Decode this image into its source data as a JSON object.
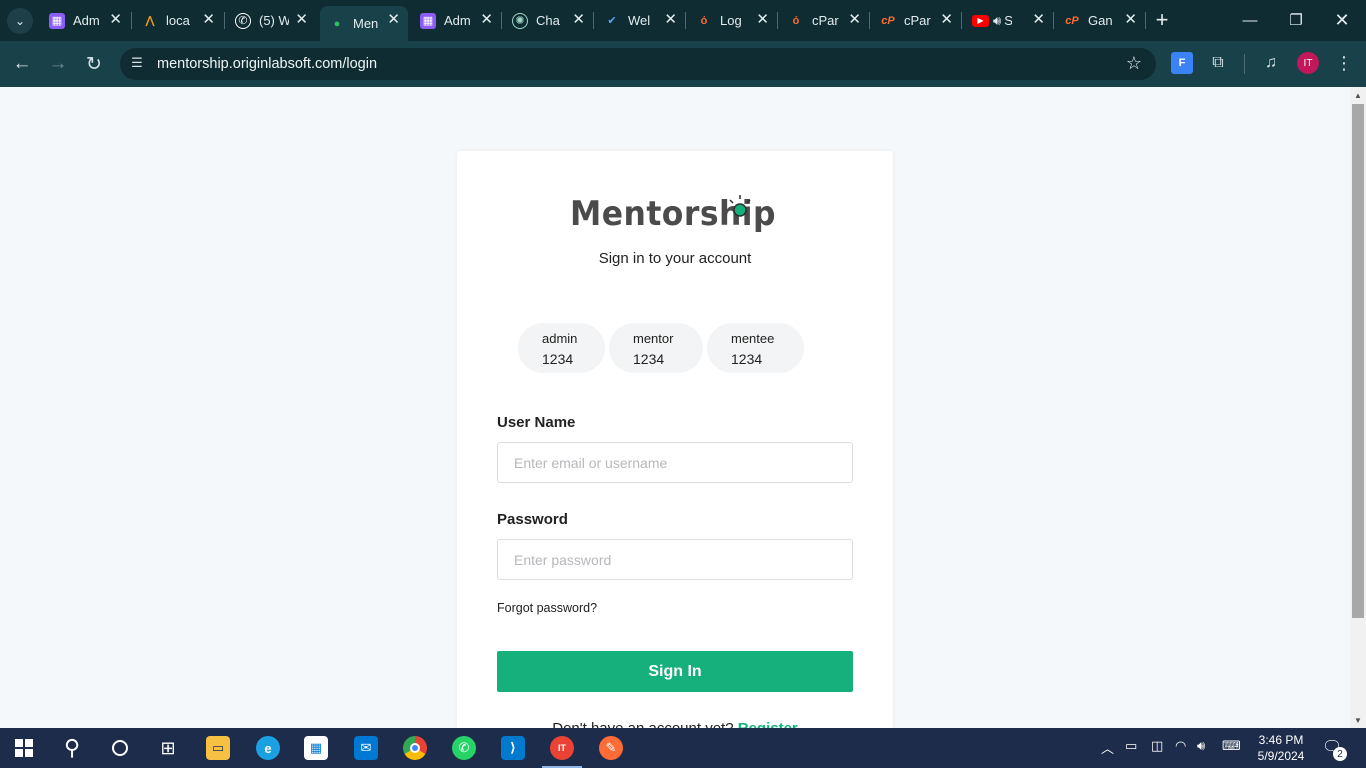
{
  "browser": {
    "tabs": [
      {
        "title": "Adm",
        "favicon": "apps-icon",
        "color": "#8b5cf6",
        "active": false
      },
      {
        "title": "loca",
        "favicon": "xampp-icon",
        "color": "#f59e0b",
        "active": false
      },
      {
        "title": "(5) W",
        "favicon": "whatsapp-icon",
        "color": "#ffffff",
        "active": false
      },
      {
        "title": "Men",
        "favicon": "map-pin-icon",
        "color": "#22c55e",
        "active": true
      },
      {
        "title": "Adm",
        "favicon": "apps-icon",
        "color": "#8b5cf6",
        "active": false
      },
      {
        "title": "Cha",
        "favicon": "chatgpt-icon",
        "color": "#9fd8c6",
        "active": false
      },
      {
        "title": "Wel",
        "favicon": "check-icon",
        "color": "#60a5fa",
        "active": false
      },
      {
        "title": "Log",
        "favicon": "cpanel-o-icon",
        "color": "#ff6c2c",
        "active": false
      },
      {
        "title": "cPar",
        "favicon": "cpanel-o-icon",
        "color": "#ff6c2c",
        "active": false
      },
      {
        "title": "cPar",
        "favicon": "cpanel-icon",
        "color": "#ff6c2c",
        "active": false
      },
      {
        "title": "S",
        "favicon": "youtube-icon",
        "color": "#ff0000",
        "active": false
      },
      {
        "title": "Gan",
        "favicon": "cpanel-icon",
        "color": "#ff6c2c",
        "active": false
      }
    ],
    "url": "mentorship.originlabsoft.com/login",
    "profile_initials": "IT"
  },
  "page": {
    "logo_text": "Mentorship",
    "subtitle": "Sign in to your account",
    "demo_credentials": [
      {
        "username": "admin",
        "password": "1234"
      },
      {
        "username": "mentor",
        "password": "1234"
      },
      {
        "username": "mentee",
        "password": "1234"
      }
    ],
    "username_label": "User Name",
    "username_placeholder": "Enter email or username",
    "password_label": "Password",
    "password_placeholder": "Enter password",
    "forgot_label": "Forgot password?",
    "signin_label": "Sign In",
    "register_prompt": "Don't have an account yet?",
    "register_link": "Register",
    "accent_color": "#16b07c"
  },
  "taskbar": {
    "time": "3:46 PM",
    "date": "5/9/2024",
    "notification_count": "2"
  }
}
